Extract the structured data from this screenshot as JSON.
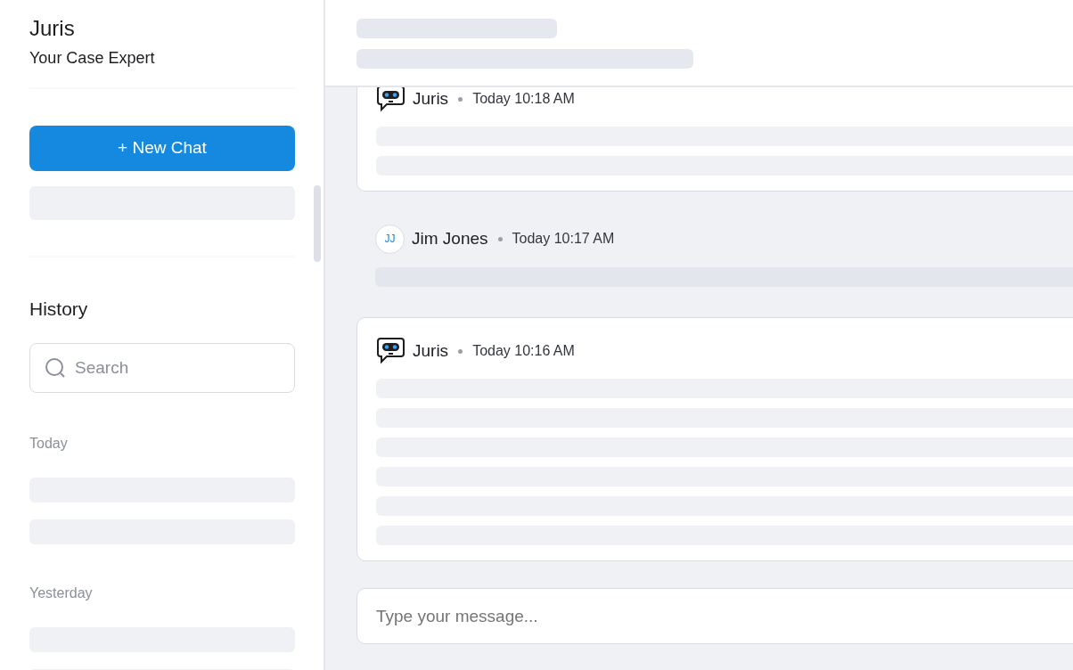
{
  "sidebar": {
    "title": "Juris",
    "subtitle": "Your Case Expert",
    "new_chat_button": "+ New Chat",
    "recent": [
      {
        "kind": "skeleton"
      }
    ],
    "history": {
      "heading": "History",
      "search": {
        "placeholder": "Search"
      },
      "groups": [
        {
          "label": "Today",
          "items": [
            {
              "kind": "skeleton"
            },
            {
              "kind": "skeleton"
            }
          ]
        },
        {
          "label": "Yesterday",
          "items": [
            {
              "kind": "skeleton"
            },
            {
              "kind": "skeleton"
            }
          ]
        }
      ]
    }
  },
  "header": {
    "lines": [
      {
        "kind": "skeleton"
      },
      {
        "kind": "skeleton"
      }
    ]
  },
  "messages": [
    {
      "kind": "bot",
      "author": "Juris",
      "time": "Today 10:18 AM",
      "lines": [
        {
          "kind": "skeleton"
        },
        {
          "kind": "skeleton"
        }
      ]
    },
    {
      "kind": "user",
      "author": "Jim Jones",
      "initials": "JJ",
      "time": "Today 10:17 AM",
      "lines": [
        {
          "kind": "skeleton"
        }
      ]
    },
    {
      "kind": "bot",
      "author": "Juris",
      "time": "Today 10:16 AM",
      "lines": [
        {
          "kind": "skeleton"
        },
        {
          "kind": "skeleton"
        },
        {
          "kind": "skeleton"
        },
        {
          "kind": "skeleton"
        },
        {
          "kind": "skeleton"
        },
        {
          "kind": "skeleton"
        }
      ]
    }
  ],
  "composer": {
    "placeholder": "Type your message..."
  }
}
